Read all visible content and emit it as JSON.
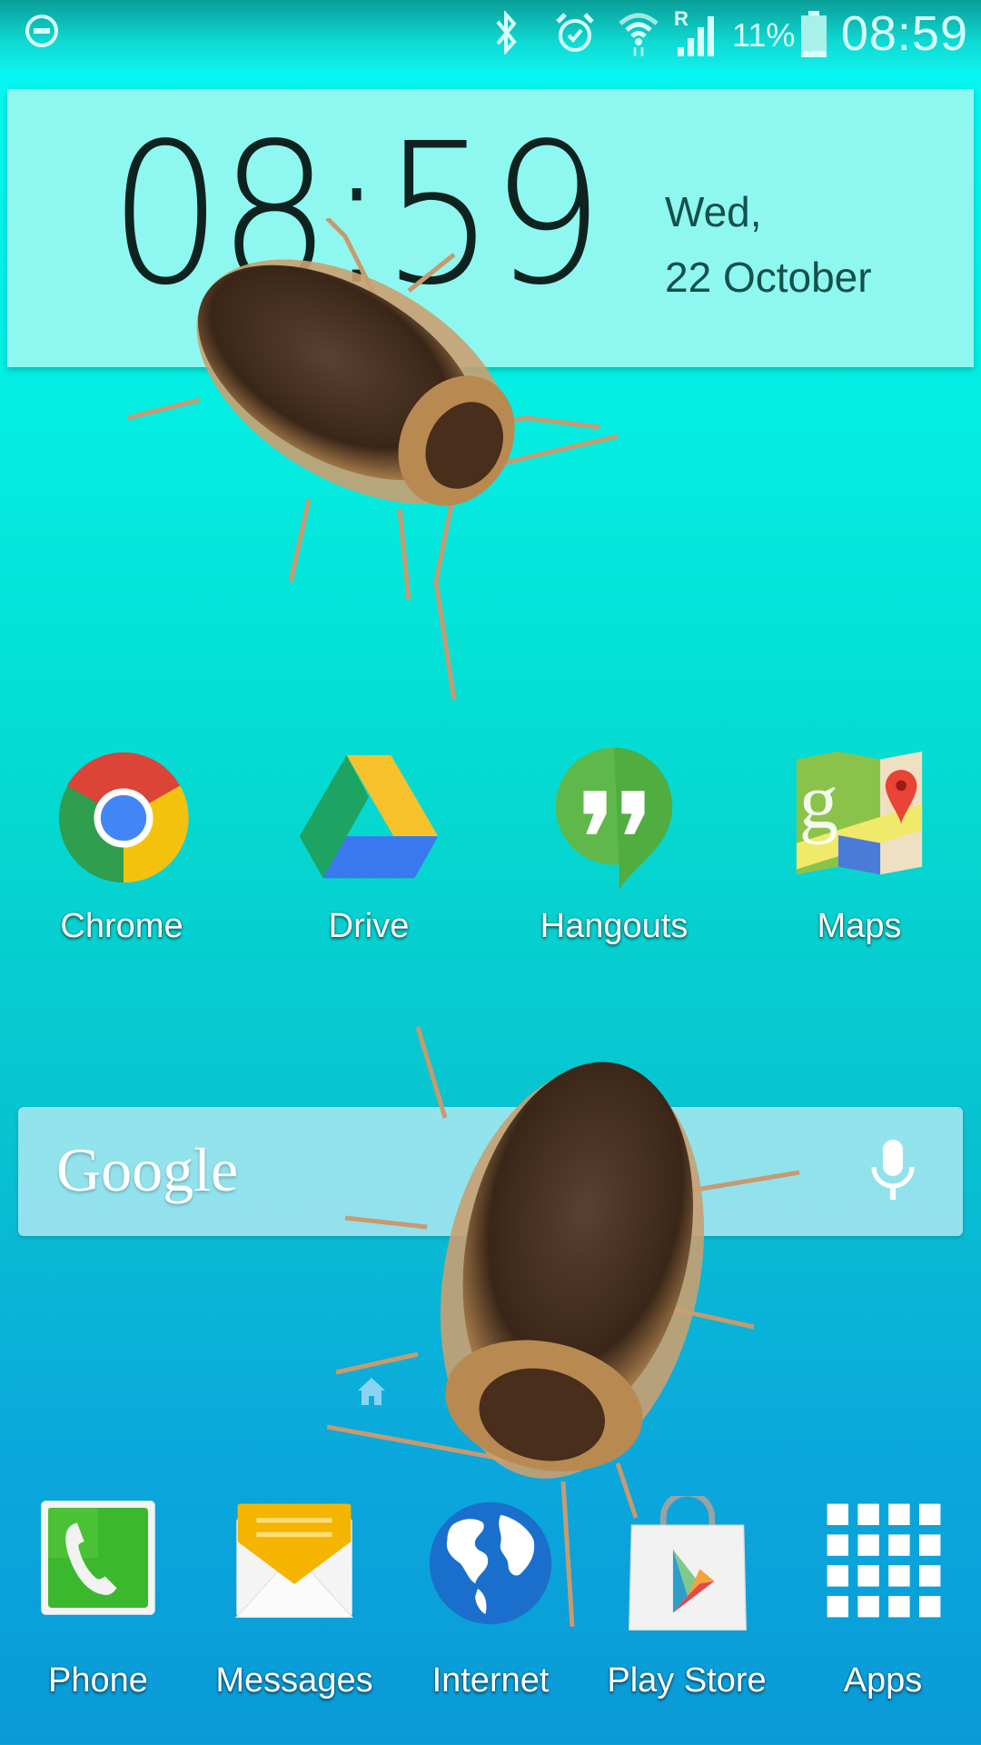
{
  "status_bar": {
    "left_icons": [
      "do-not-disturb-icon"
    ],
    "right_icons": [
      "bluetooth-icon",
      "alarm-icon",
      "wifi-icon",
      "roaming-signal-icon",
      "battery-icon"
    ],
    "roaming_label": "R",
    "battery_percent": "11%",
    "battery_level": 0.11,
    "time": "08:59"
  },
  "clock_widget": {
    "time": "08:59",
    "day": "Wed,",
    "date": "22 October"
  },
  "home_apps": [
    {
      "label": "Chrome",
      "icon": "chrome-icon"
    },
    {
      "label": "Drive",
      "icon": "drive-icon"
    },
    {
      "label": "Hangouts",
      "icon": "hangouts-icon"
    },
    {
      "label": "Maps",
      "icon": "maps-icon"
    }
  ],
  "search": {
    "logo": "Google",
    "mic_icon": "microphone-icon"
  },
  "page_indicator": {
    "icon": "home-page-icon"
  },
  "dock": [
    {
      "label": "Phone",
      "icon": "phone-icon"
    },
    {
      "label": "Messages",
      "icon": "messages-icon"
    },
    {
      "label": "Internet",
      "icon": "internet-globe-icon"
    },
    {
      "label": "Play Store",
      "icon": "play-store-icon"
    },
    {
      "label": "Apps",
      "icon": "apps-grid-icon"
    }
  ],
  "overlay": {
    "insects": [
      "cockroach",
      "cockroach"
    ]
  },
  "colors": {
    "status_text": "#d8fffb",
    "clock_text": "#0e2220",
    "date_text": "#14504c",
    "widget_bg": "#8ef8f0"
  }
}
